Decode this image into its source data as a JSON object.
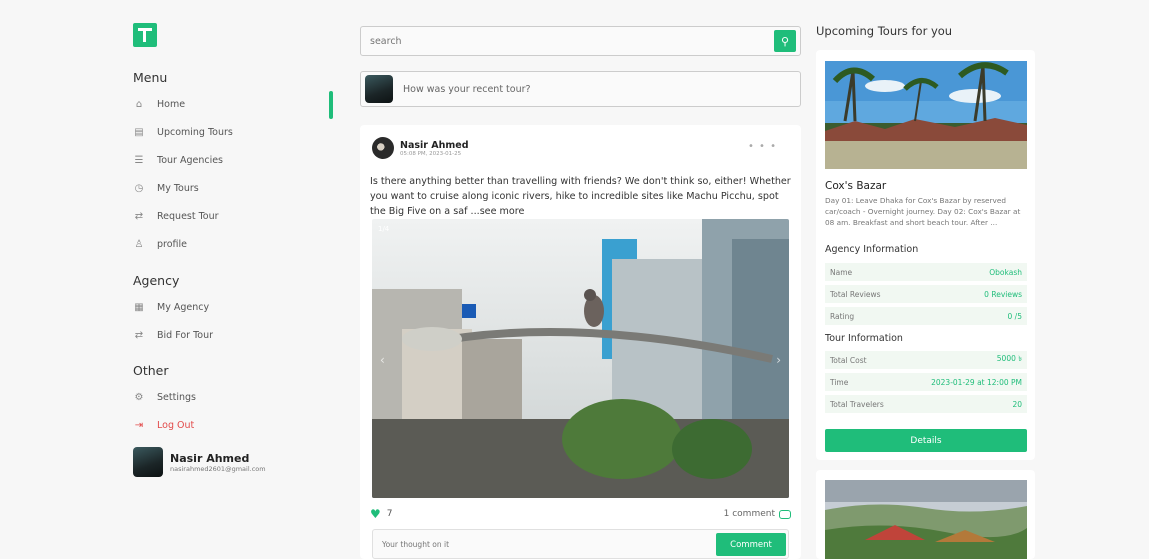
{
  "sidebar": {
    "menu_title": "Menu",
    "menu_items": [
      {
        "label": "Home",
        "icon": "home-icon"
      },
      {
        "label": "Upcoming Tours",
        "icon": "calendar-icon"
      },
      {
        "label": "Tour Agencies",
        "icon": "list-icon"
      },
      {
        "label": "My Tours",
        "icon": "clock-icon"
      },
      {
        "label": "Request Tour",
        "icon": "route-icon"
      },
      {
        "label": "profile",
        "icon": "user-icon"
      }
    ],
    "agency_title": "Agency",
    "agency_items": [
      {
        "label": "My Agency",
        "icon": "building-icon"
      },
      {
        "label": "Bid For Tour",
        "icon": "route-icon"
      }
    ],
    "other_title": "Other",
    "other_items": [
      {
        "label": "Settings",
        "icon": "gear-icon"
      },
      {
        "label": "Log Out",
        "icon": "logout-icon"
      }
    ],
    "user": {
      "name": "Nasir Ahmed",
      "email": "nasirahmed2601@gmail.com"
    }
  },
  "search": {
    "placeholder": "search"
  },
  "compose": {
    "placeholder": "How was your recent tour?"
  },
  "post": {
    "author": "Nasir Ahmed",
    "time": "05:08 PM, 2023-01-25",
    "text": "Is there anything better than travelling with friends? We don't think so, either! Whether you want to cruise along iconic rivers, hike to incredible sites like Machu Picchu, spot the Big Five on a saf ...",
    "see_more": "see more",
    "image_counter": "1/4",
    "likes": "7",
    "comments": "1 comment",
    "comment_placeholder": "Your thought on it",
    "comment_button": "Comment"
  },
  "upcoming": {
    "title": "Upcoming Tours for you",
    "tour": {
      "name": "Cox's Bazar",
      "description": "Day 01: Leave Dhaka for Cox's Bazar by reserved car/coach - Overnight journey. Day 02: Cox's Bazar at 08 am. Breakfast and short beach tour. After ...",
      "agency_heading": "Agency Information",
      "agency_rows": [
        {
          "key": "Name",
          "value": "Obokash"
        },
        {
          "key": "Total Reviews",
          "value": "0 Reviews"
        },
        {
          "key": "Rating",
          "value": "0 /5"
        }
      ],
      "tour_heading": "Tour Information",
      "tour_rows": [
        {
          "key": "Total Cost",
          "value": "5000 ৳"
        },
        {
          "key": "Time",
          "value": "2023-01-29 at 12:00 PM"
        },
        {
          "key": "Total Travelers",
          "value": "20"
        }
      ],
      "button": "Details"
    }
  },
  "colors": {
    "accent": "#1fbd7a",
    "danger": "#e24a4a"
  }
}
